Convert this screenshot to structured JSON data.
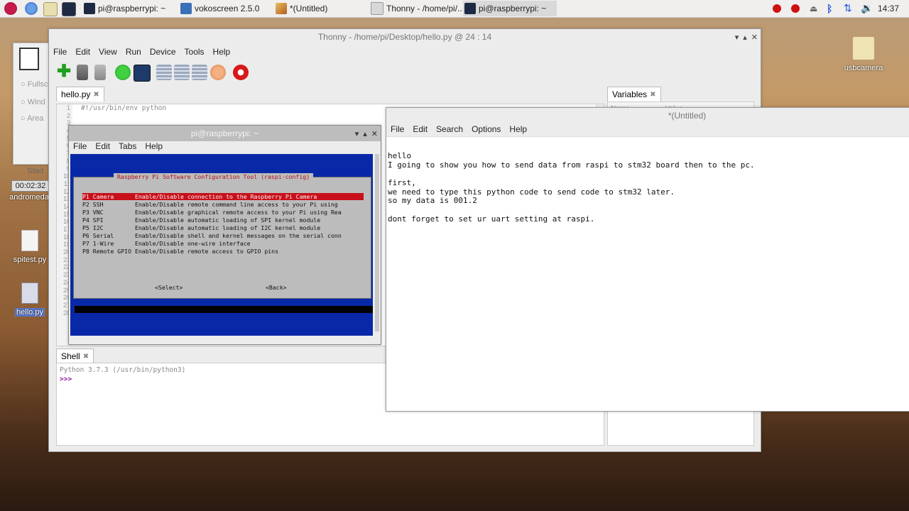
{
  "taskbar": {
    "tasks": [
      {
        "label": "pi@raspberrypi: ~"
      },
      {
        "label": "vokoscreen 2.5.0"
      },
      {
        "label": "*(Untitled)"
      },
      {
        "label": "Thonny  -  /home/pi/..."
      },
      {
        "label": "pi@raspberrypi: ~"
      }
    ],
    "clock": "14:37"
  },
  "desktop": {
    "icons": [
      {
        "label": "usbcamera"
      },
      {
        "label": "andromeda"
      },
      {
        "label": "spitest.py"
      },
      {
        "label": "hello.py"
      }
    ]
  },
  "vokoscreen": {
    "options": [
      "Fullsc",
      "Wind",
      "Area"
    ],
    "start_label": "Start",
    "timer": "00:02:32"
  },
  "thonny": {
    "title": "Thonny  -  /home/pi/Desktop/hello.py  @  24 : 14",
    "menu": [
      "File",
      "Edit",
      "View",
      "Run",
      "Device",
      "Tools",
      "Help"
    ],
    "editor_tab": "hello.py",
    "code_first_line": "#!/usr/bin/env python",
    "line_numbers": [
      "1",
      "2",
      "3",
      "4",
      "5",
      "6",
      "7",
      "8",
      "9",
      "10",
      "11",
      "12",
      "13",
      "14",
      "15",
      "16",
      "17",
      "18",
      "19",
      "20",
      "21",
      "22",
      "23",
      "24",
      "25",
      "26",
      "27",
      "28"
    ],
    "variables_tab": "Variables",
    "variables_cols": [
      "Name",
      "Value"
    ],
    "shell_tab": "Shell",
    "shell_line": "Python 3.7.3 (/usr/bin/python3)",
    "prompt": ">>>"
  },
  "terminal": {
    "title": "pi@raspberrypi: ~",
    "menu": [
      "File",
      "Edit",
      "Tabs",
      "Help"
    ],
    "raspi_config": {
      "title": "Raspberry Pi Software Configuration Tool (raspi-config)",
      "rows": [
        "P1 Camera      Enable/Disable connection to the Raspberry Pi Camera",
        "P2 SSH         Enable/Disable remote command line access to your Pi using",
        "P3 VNC         Enable/Disable graphical remote access to your Pi using Rea",
        "P4 SPI         Enable/Disable automatic loading of SPI kernel module",
        "P5 I2C         Enable/Disable automatic loading of I2C kernel module",
        "P6 Serial      Enable/Disable shell and kernel messages on the serial conn",
        "P7 1-Wire      Enable/Disable one-wire interface",
        "P8 Remote GPIO Enable/Disable remote access to GPIO pins"
      ],
      "select_btn": "<Select>",
      "back_btn": "<Back>"
    }
  },
  "leafpad": {
    "title": "*(Untitled)",
    "menu": [
      "File",
      "Edit",
      "Search",
      "Options",
      "Help"
    ],
    "text": "hello\nI going to show you how to send data from raspi to stm32 board then to the pc.\n\nfirst,\nwe need to type this python code to send code to stm32 later.\nso my data is 001.2\n\ndont forget to set ur uart setting at raspi."
  }
}
